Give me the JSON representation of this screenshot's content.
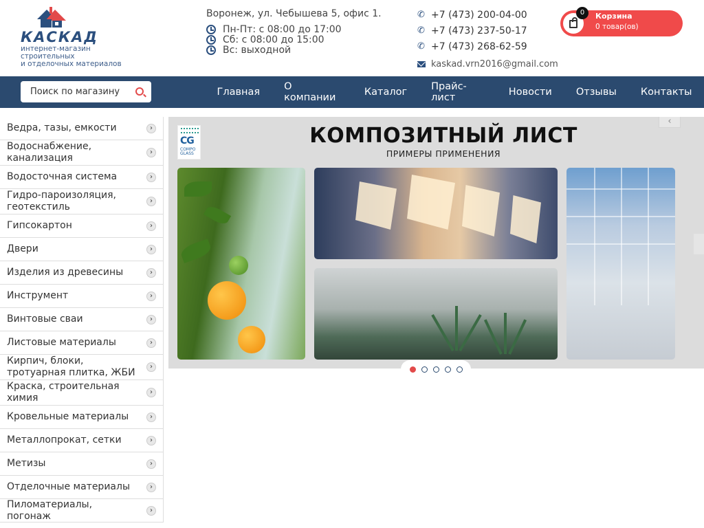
{
  "header": {
    "logo_name": "КАСКАД",
    "logo_tagline": [
      "интернет-магазин",
      "строительных",
      "и отделочных материалов"
    ],
    "address": "Воронеж, ул. Чебышева 5, офис 1.",
    "hours": [
      "Пн-Пт: с 08:00 до 17:00",
      "Сб: с 08:00 до 15:00",
      "Вс: выходной"
    ],
    "phones": [
      "+7 (473) 200-04-00",
      "+7 (473) 237-50-17",
      "+7 (473) 268-62-59"
    ],
    "email": "kaskad.vrn2016@gmail.com",
    "cart": {
      "title": "Корзина",
      "items_text": "0 товар(ов)",
      "count": "0"
    }
  },
  "colors": {
    "nav": "#2b4a6f",
    "accent": "#f04a4a",
    "brand": "#2b4f7e"
  },
  "search": {
    "placeholder": "Поиск по магазину"
  },
  "menu": [
    "Главная",
    "О компании",
    "Каталог",
    "Прайс-лист",
    "Новости",
    "Отзывы",
    "Контакты"
  ],
  "categories": [
    "Ведра, тазы, емкости",
    "Водоснабжение, канализация",
    "Водосточная система",
    "Гидро-пароизоляция, геотекстиль",
    "Гипсокартон",
    "Двери",
    "Изделия из древесины",
    "Инструмент",
    "Винтовые сваи",
    "Листовые материалы",
    "Кирпич, блоки, тротуарная плитка, ЖБИ",
    "Краска, строительная химия",
    "Кровельные материалы",
    "Металлопрокат, сетки",
    "Метизы",
    "Отделочные материалы",
    "Пиломатериалы, погонаж"
  ],
  "banner": {
    "title": "КОМПОЗИТНЫЙ ЛИСТ",
    "subtitle": "ПРИМЕРЫ ПРИМЕНЕНИЯ",
    "brand_logo": {
      "mark": "CG",
      "lines": [
        "COMPO",
        "GLASS"
      ]
    },
    "slide_count": 5,
    "active_slide": 1
  }
}
